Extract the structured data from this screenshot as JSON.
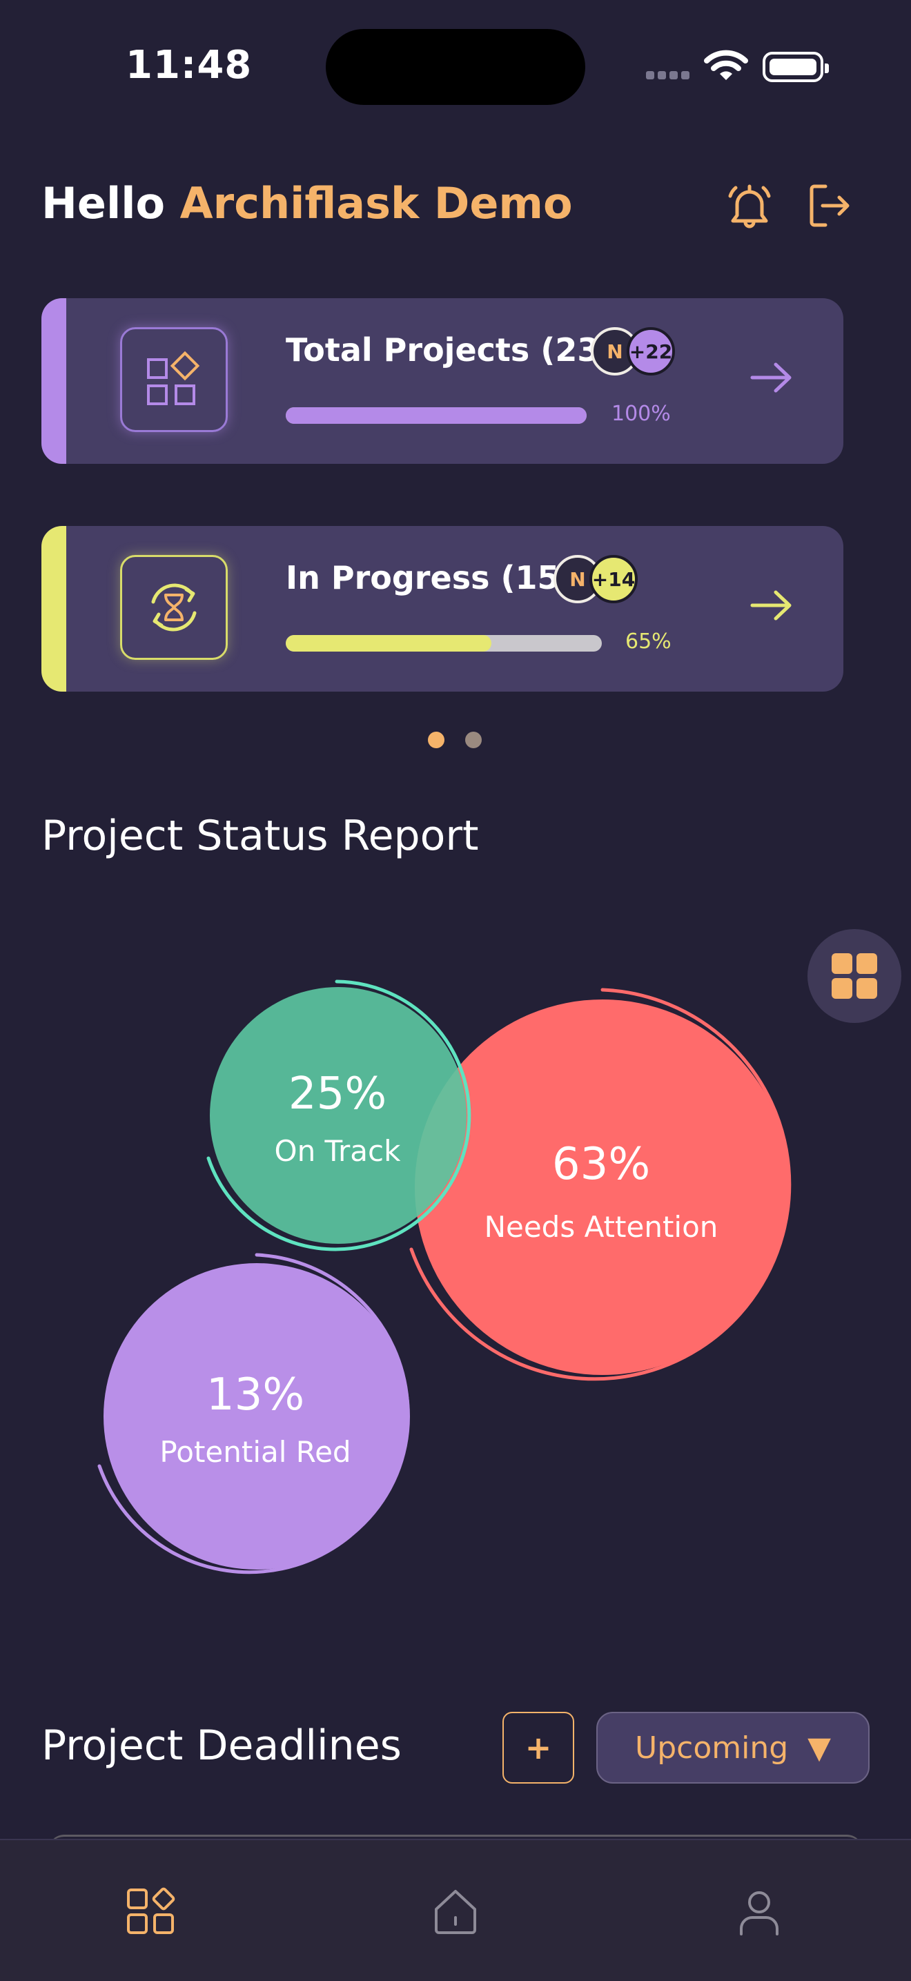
{
  "status_bar": {
    "time": "11:48"
  },
  "header": {
    "greeting": "Hello",
    "user_name": "Archiflask Demo",
    "bell_icon": "bell-icon",
    "logout_icon": "logout-icon"
  },
  "summary_cards": [
    {
      "title": "Total Projects (23)",
      "avatar_initial": "N",
      "avatar_more": "+22",
      "progress_label": "100%",
      "progress": 1.0,
      "accent_color": "#b48ae8",
      "icon": "grid-shapes-icon"
    },
    {
      "title": "In Progress (15)",
      "avatar_initial": "N",
      "avatar_more": "+14",
      "progress_label": "65%",
      "progress": 0.65,
      "accent_color": "#e6e872",
      "icon": "refresh-hourglass-icon"
    }
  ],
  "pager": {
    "count": 2,
    "active": 0
  },
  "status_report": {
    "title": "Project Status Report",
    "bubbles": [
      {
        "percent": "25%",
        "label": "On Track",
        "color": "#5bc4a0"
      },
      {
        "percent": "63%",
        "label": "Needs Attention",
        "color": "#ff6b6b"
      },
      {
        "percent": "13%",
        "label": "Potential Red",
        "color": "#b98fe8"
      }
    ],
    "fab_icon": "grid-icon"
  },
  "deadlines": {
    "title": "Project Deadlines",
    "add_label": "+",
    "filter_value": "Upcoming",
    "filter_caret": "▼"
  },
  "tab_bar": {
    "tabs": [
      {
        "name": "dashboard",
        "icon": "dashboard-icon",
        "active": true
      },
      {
        "name": "home",
        "icon": "home-icon",
        "active": false
      },
      {
        "name": "profile",
        "icon": "user-icon",
        "active": false
      }
    ]
  },
  "colors": {
    "background": "#232036",
    "card": "#463e65",
    "accent": "#f5b36a"
  }
}
